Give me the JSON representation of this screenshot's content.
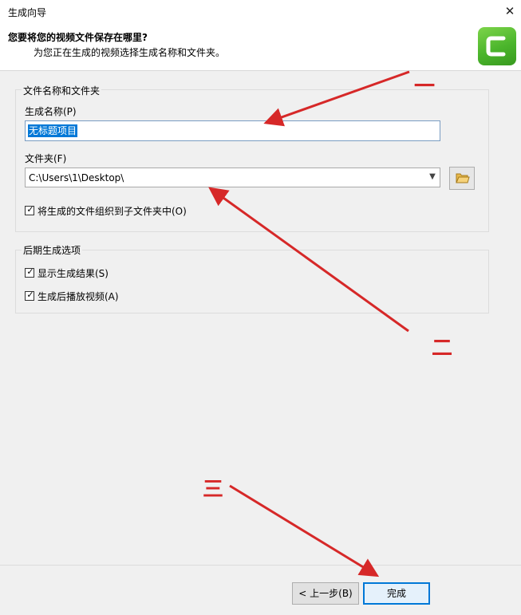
{
  "window": {
    "title": "生成向导",
    "close_glyph": "✕"
  },
  "header": {
    "question": "您要将您的视频文件保存在哪里?",
    "subtitle": "为您正在生成的视频选择生成名称和文件夹。",
    "logo_letter": "C"
  },
  "file_group": {
    "legend": "文件名称和文件夹",
    "name_label": "生成名称(P)",
    "name_value": "无标题项目",
    "folder_label": "文件夹(F)",
    "folder_value": "C:\\Users\\1\\Desktop\\",
    "browse_icon": "folder-icon",
    "subfolder_label": "将生成的文件组织到子文件夹中(O)",
    "subfolder_checked": true
  },
  "post_group": {
    "legend": "后期生成选项",
    "show_results_label": "显示生成结果(S)",
    "show_results_checked": true,
    "play_after_label": "生成后播放视频(A)",
    "play_after_checked": true
  },
  "buttons": {
    "back": "< 上一步(B)",
    "finish": "完成"
  },
  "annotations": {
    "one": "一",
    "two": "二",
    "three": "三",
    "color": "#d62828"
  },
  "colors": {
    "accent": "#0078d7",
    "logo_green": "#4bb52c"
  }
}
